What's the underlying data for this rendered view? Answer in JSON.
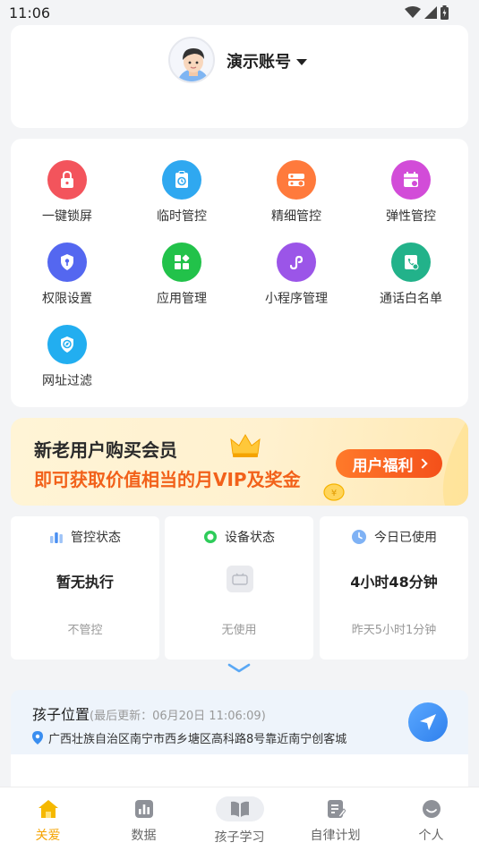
{
  "status_bar": {
    "time": "11:06"
  },
  "account": {
    "name": "演示账号"
  },
  "functions": [
    {
      "label": "一键锁屏",
      "icon": "lock-icon",
      "color": "#f3545c"
    },
    {
      "label": "临时管控",
      "icon": "timer-clipboard-icon",
      "color": "#2fa8f0"
    },
    {
      "label": "精细管控",
      "icon": "settings-panel-icon",
      "color": "#ff7a3c"
    },
    {
      "label": "弹性管控",
      "icon": "calendar-icon",
      "color": "#d24cd8"
    },
    {
      "label": "权限设置",
      "icon": "shield-key-icon",
      "color": "#5467f0"
    },
    {
      "label": "应用管理",
      "icon": "apps-grid-icon",
      "color": "#22c24a"
    },
    {
      "label": "小程序管理",
      "icon": "mini-program-icon",
      "color": "#9b55e8"
    },
    {
      "label": "通话白名单",
      "icon": "phone-check-icon",
      "color": "#22b28a"
    },
    {
      "label": "网址过滤",
      "icon": "compass-shield-icon",
      "color": "#22aef0"
    }
  ],
  "banner": {
    "line1": "新老用户购买会员",
    "line2": "即可获取价值相当的月VIP及奖金",
    "button": "用户福利"
  },
  "stats": [
    {
      "title": "管控状态",
      "value": "暂无执行",
      "sub": "不管控",
      "icon": "bar-chart-icon"
    },
    {
      "title": "设备状态",
      "value": "",
      "sub": "无使用",
      "icon": "online-dot-icon"
    },
    {
      "title": "今日已使用",
      "value": "4小时48分钟",
      "sub": "昨天5小时1分钟",
      "icon": "clock-icon"
    }
  ],
  "location": {
    "title": "孩子位置",
    "update": "(最后更新：06月20日 11:06:09)",
    "address": "广西壮族自治区南宁市西乡塘区高科路8号靠近南宁创客城"
  },
  "tabs": [
    {
      "label": "关爱",
      "icon": "home-icon",
      "active": true
    },
    {
      "label": "数据",
      "icon": "chart-icon",
      "active": false
    },
    {
      "label": "孩子学习",
      "icon": "book-icon",
      "active": false
    },
    {
      "label": "自律计划",
      "icon": "plan-icon",
      "active": false
    },
    {
      "label": "个人",
      "icon": "user-icon",
      "active": false
    }
  ],
  "colors": {
    "accent": "#f5a300",
    "banner_orange": "#f2611a",
    "background": "#f3f4f6"
  }
}
